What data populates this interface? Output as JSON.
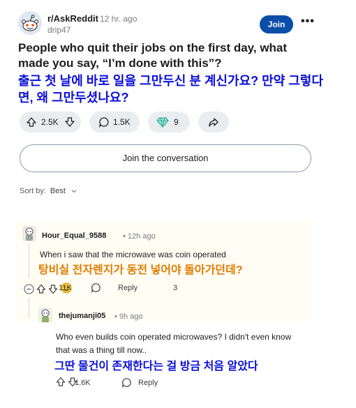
{
  "post": {
    "subreddit": "r/AskReddit",
    "time": "12 hr. ago",
    "author": "drip47",
    "join_label": "Join",
    "title_en": "People who quit their jobs on the first day, what made you say, “I’m done with this”?",
    "title_ko": "출근 첫 날에 바로 일을 그만두신 분 계신가요? 만약 그렇다면, 왜 그만두셨나요?",
    "upvotes": "2.5K",
    "comments": "1.5K",
    "awards": "9"
  },
  "join_conversation": "Join the conversation",
  "sort": {
    "label": "Sort by:",
    "value": "Best"
  },
  "comments": [
    {
      "user": "Hour_Equal_9588",
      "time": "12h ago",
      "text": "When i saw that the microwave was coin operated",
      "translation": "탕비실 전자렌지가 동전 넣어야 돌아가던데?",
      "votes": "11K",
      "reply_label": "Reply",
      "awards": "3"
    },
    {
      "user": "thejumanji05",
      "time": "9h ago",
      "text": "Who even builds coin operated microwaves? I didn't even know that was a thing till now..",
      "translation": "그딴 물건이 존재한다는 걸 방금 처음 알았다",
      "votes": "1.6K",
      "reply_label": "Reply"
    }
  ],
  "colors": {
    "join_button": "#0a4ea9",
    "korean_blue": "#0a0fd6",
    "korean_orange": "#e07c00",
    "pill_bg": "#eaedef",
    "comment_highlight": "#fffdf4"
  },
  "icons": [
    "reddit-snoo-icon",
    "more-icon",
    "upvote-icon",
    "downvote-icon",
    "comment-icon",
    "award-icon",
    "share-icon",
    "chevron-down-icon",
    "collapse-icon",
    "reply-icon"
  ]
}
